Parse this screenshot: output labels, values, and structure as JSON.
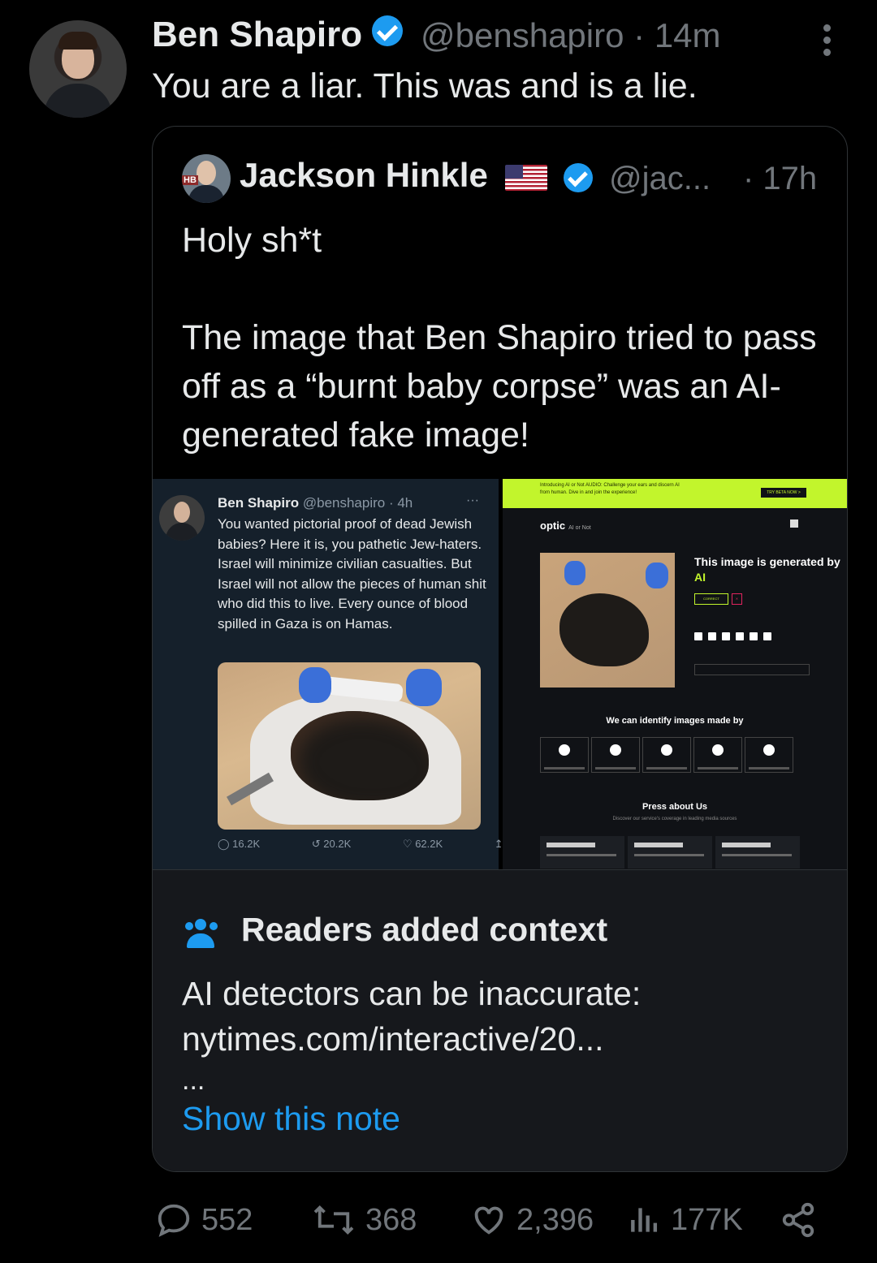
{
  "tweet": {
    "author_name": "Ben Shapiro",
    "handle": "@benshapiro",
    "separator": "·",
    "time": "14m",
    "text": "You are a liar. This was and is a lie."
  },
  "quoted": {
    "author_name": "Jackson Hinkle",
    "handle": "@jac...",
    "time": "· 17h",
    "text": "Holy sh*t\n\nThe image that Ben Shapiro tried to pass off as a “burnt baby corpse” was an AI-generated fake image!",
    "embedded_left": {
      "name": "Ben Shapiro",
      "handle": "@benshapiro · 4h",
      "more": "···",
      "text": "You wanted pictorial proof of dead Jewish babies? Here it is, you pathetic Jew-haters. Israel will minimize civilian casualties. But Israel will not allow the pieces of human shit who did this to live. Every ounce of blood spilled in Gaza is on Hamas.",
      "replies": "16.2K",
      "retweets": "20.2K",
      "likes": "62.2K"
    },
    "embedded_right": {
      "banner_text": "Introducing AI or Not AUDIO: Challenge your ears and discern AI from human. Dive in and join the experience!",
      "banner_button": "TRY BETA NOW >",
      "logo": "optic",
      "logo_sub": "AI or Not",
      "result_prefix": "This image is generated by",
      "result_ai": "AI",
      "correct_label": "CORRECT",
      "identify_title": "We can identify images made by",
      "press_title": "Press about Us",
      "press_sub": "Discover our service's coverage in leading media sources",
      "accent": "#c2f52c"
    },
    "note": {
      "title": "Readers added context",
      "body": "AI detectors can be inaccurate: nytimes.com/interactive/20...",
      "ellipsis": "...",
      "link": "Show this note"
    }
  },
  "actions": {
    "replies": "552",
    "reposts": "368",
    "likes": "2,396",
    "views": "177K"
  },
  "colors": {
    "background": "#000000",
    "text": "#e7e9ea",
    "muted": "#71767b",
    "accent_blue": "#1d9bf0"
  }
}
